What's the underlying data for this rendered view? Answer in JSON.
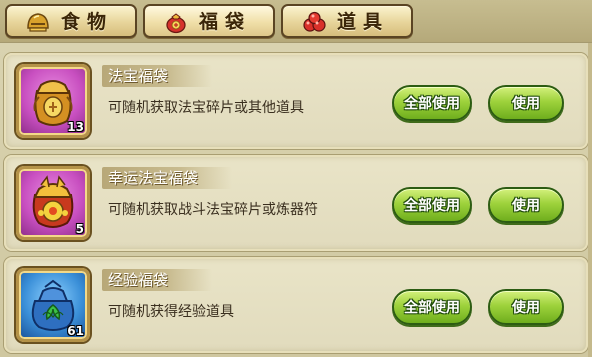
{
  "tabs": [
    {
      "label": "食物",
      "icon": "helmet-icon"
    },
    {
      "label": "福袋",
      "icon": "lucky-bag-icon"
    },
    {
      "label": "道具",
      "icon": "berries-icon"
    }
  ],
  "items": [
    {
      "name": "法宝福袋",
      "description": "可随机获取法宝碎片或其他道具",
      "quantity": "13",
      "icon": "gold-treasure-bag-icon",
      "frame_color": "#c84fc0"
    },
    {
      "name": "幸运法宝福袋",
      "description": "可随机获取战斗法宝碎片或炼器符",
      "quantity": "5",
      "icon": "lucky-treasure-bag-icon",
      "frame_color": "#c84fc0"
    },
    {
      "name": "经验福袋",
      "description": "可随机获得经验道具",
      "quantity": "61",
      "icon": "experience-bag-icon",
      "frame_color": "#3a8fd8"
    }
  ],
  "buttons": {
    "use_all": "全部使用",
    "use": "使用"
  },
  "colors": {
    "button_green": "#9ed23c",
    "tab_gold": "#e7d49a",
    "panel": "#d9d3b0"
  }
}
